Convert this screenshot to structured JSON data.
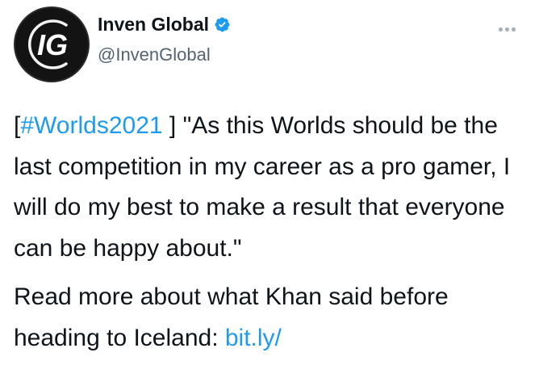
{
  "author": {
    "display_name": "Inven Global",
    "handle": "@InvenGlobal",
    "avatar_text": "IG",
    "verified": true
  },
  "more_icon": "more-horizontal-icon",
  "tweet": {
    "bracket_open": "[",
    "hashtag": "#Worlds2021",
    "quote_text": " ] \"As this Worlds should be the last competition in my career as a pro gamer, I will do my best to make a result that everyone can be happy about.\"",
    "read_more_text": "Read more about what Khan said before heading to Iceland: ",
    "link_text": "bit.ly/"
  },
  "colors": {
    "link": "#1d9bf0",
    "verified_badge": "#1d9bf0",
    "text": "#0f1419",
    "secondary": "#536471",
    "avatar_bg": "#131313"
  }
}
